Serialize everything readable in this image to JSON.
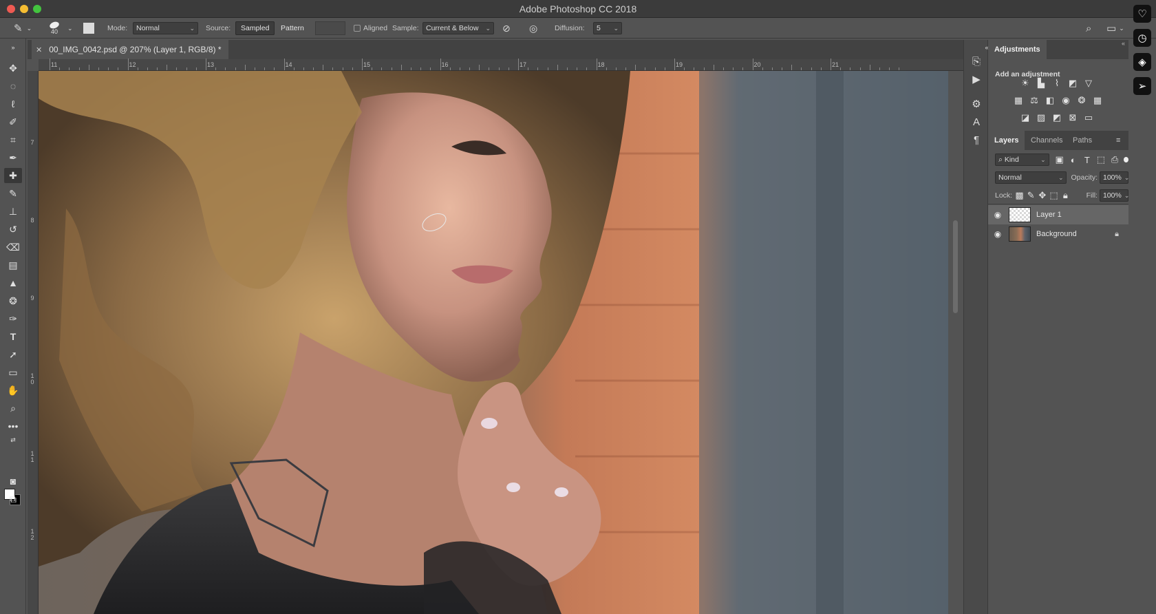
{
  "app": {
    "title": "Adobe Photoshop CC 2018"
  },
  "options": {
    "brush_size": "40",
    "mode_label": "Mode:",
    "mode_value": "Normal",
    "source_label": "Source:",
    "source_sampled": "Sampled",
    "source_pattern": "Pattern",
    "aligned_label": "Aligned",
    "sample_label": "Sample:",
    "sample_value": "Current & Below",
    "diffusion_label": "Diffusion:",
    "diffusion_value": "5"
  },
  "document": {
    "tab_title": "00_IMG_0042.psd @ 207% (Layer 1, RGB/8) *",
    "ruler_top": [
      "11",
      "12",
      "13",
      "14",
      "15",
      "16",
      "17",
      "18",
      "19",
      "20",
      "21"
    ],
    "ruler_left": [
      "7",
      "8",
      "9",
      "1\n0",
      "1\n1",
      "1\n2"
    ]
  },
  "adjustments": {
    "tab": "Adjustments",
    "subtitle": "Add an adjustment",
    "row1": [
      "brightness-contrast-icon",
      "levels-icon",
      "curves-icon",
      "exposure-icon",
      "vibrance-icon"
    ],
    "row2": [
      "hue-saturation-icon",
      "color-balance-icon",
      "black-white-icon",
      "photo-filter-icon",
      "channel-mixer-icon",
      "color-lookup-icon"
    ],
    "row3": [
      "invert-icon",
      "posterize-icon",
      "threshold-icon",
      "selective-color-icon",
      "gradient-map-icon"
    ]
  },
  "layers_panel": {
    "tabs": [
      "Layers",
      "Channels",
      "Paths"
    ],
    "kind_label": "Kind",
    "blend_mode": "Normal",
    "opacity_label": "Opacity:",
    "opacity_value": "100%",
    "lock_label": "Lock:",
    "fill_label": "Fill:",
    "fill_value": "100%",
    "layers": [
      {
        "name": "Layer 1",
        "selected": true
      },
      {
        "name": "Background",
        "selected": false
      }
    ]
  }
}
